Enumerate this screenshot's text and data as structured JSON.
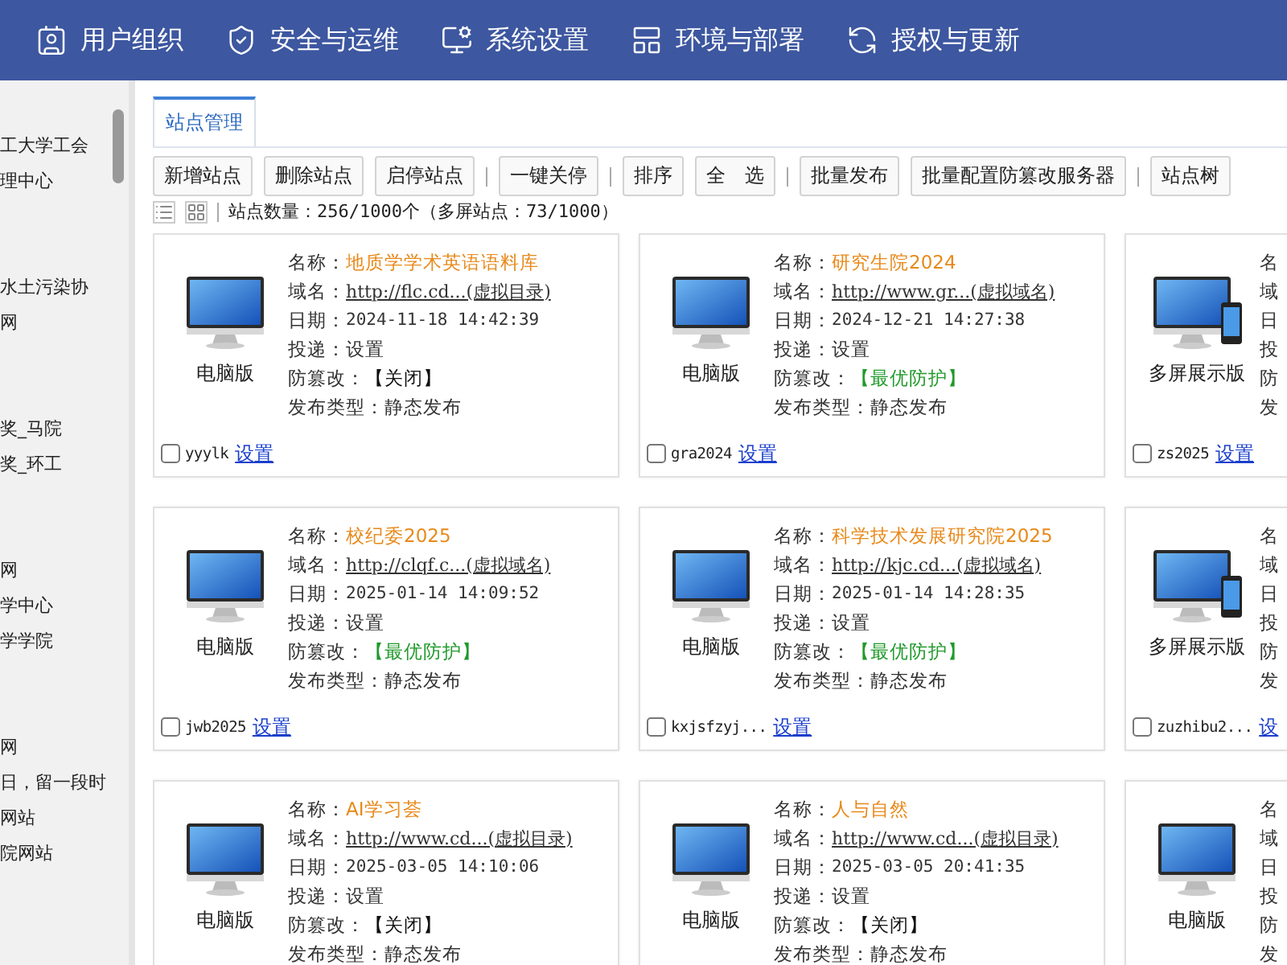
{
  "nav": {
    "items": [
      {
        "label": "用户组织"
      },
      {
        "label": "安全与运维"
      },
      {
        "label": "系统设置"
      },
      {
        "label": "环境与部署"
      },
      {
        "label": "授权与更新"
      }
    ]
  },
  "sidebar": {
    "groups": [
      {
        "lines": [
          "工大学工会",
          "理中心"
        ]
      },
      {
        "lines": [
          "水土污染协",
          "网"
        ]
      },
      {
        "lines": [
          "奖_马院",
          "奖_环工"
        ]
      },
      {
        "lines": [
          "网",
          "学中心",
          "学学院"
        ]
      },
      {
        "lines": [
          "网",
          "日，留一段时",
          "网站",
          "院网站"
        ]
      }
    ]
  },
  "tabs": [
    {
      "label": "站点管理",
      "selected": true
    }
  ],
  "toolbar": [
    {
      "kind": "button",
      "label": "新增站点"
    },
    {
      "kind": "button",
      "label": "删除站点"
    },
    {
      "kind": "button",
      "label": "启停站点"
    },
    {
      "kind": "separator"
    },
    {
      "kind": "button",
      "label": "一键关停"
    },
    {
      "kind": "separator"
    },
    {
      "kind": "button",
      "label": "排序"
    },
    {
      "kind": "button",
      "label": "全　选"
    },
    {
      "kind": "separator"
    },
    {
      "kind": "button",
      "label": "批量发布"
    },
    {
      "kind": "button",
      "label": "批量配置防篡改服务器"
    },
    {
      "kind": "separator"
    },
    {
      "kind": "button",
      "label": "站点树"
    }
  ],
  "status": {
    "text": "站点数量：256/1000个（多屏站点：73/1000）"
  },
  "cards": [
    {
      "kind": "pc",
      "device_label": "电脑版",
      "fields": [
        {
          "label": "名称：",
          "value": "地质学学术英语语料库",
          "kind": "title"
        },
        {
          "label": "域名：",
          "value": "http://flc.cd...(虚拟目录)",
          "kind": "url"
        },
        {
          "label": "日期：",
          "value": "2024-11-18 14:42:39",
          "kind": "plain"
        },
        {
          "label": "投递：",
          "value": "设置",
          "kind": "plain"
        },
        {
          "label": "防篡改：",
          "value": "【关闭】",
          "kind": "protection",
          "on": false
        },
        {
          "label": "发布类型：",
          "value": "静态发布",
          "kind": "plain"
        }
      ],
      "account": "yyylk",
      "link": "设置",
      "checked": false
    },
    {
      "kind": "pc",
      "device_label": "电脑版",
      "fields": [
        {
          "label": "名称：",
          "value": "研究生院2024",
          "kind": "title"
        },
        {
          "label": "域名：",
          "value": "http://www.gr...(虚拟域名)",
          "kind": "url"
        },
        {
          "label": "日期：",
          "value": "2024-12-21 14:27:38",
          "kind": "plain"
        },
        {
          "label": "投递：",
          "value": "设置",
          "kind": "plain"
        },
        {
          "label": "防篡改：",
          "value": "【最优防护】",
          "kind": "protection",
          "on": true
        },
        {
          "label": "发布类型：",
          "value": "静态发布",
          "kind": "plain"
        }
      ],
      "account": "gra2024",
      "link": "设置",
      "checked": false
    },
    {
      "kind": "multi",
      "device_label": "多屏展示版",
      "fields": [
        {
          "label": "名"
        },
        {
          "label": "域"
        },
        {
          "label": "日"
        },
        {
          "label": "投"
        },
        {
          "label": "防"
        },
        {
          "label": "发"
        }
      ],
      "account": "zs2025",
      "link": "设置",
      "checked": false
    },
    {
      "kind": "pc",
      "device_label": "电脑版",
      "fields": [
        {
          "label": "名称：",
          "value": "校纪委2025",
          "kind": "title"
        },
        {
          "label": "域名：",
          "value": "http://clqf.c...(虚拟域名)",
          "kind": "url"
        },
        {
          "label": "日期：",
          "value": "2025-01-14 14:09:52",
          "kind": "plain"
        },
        {
          "label": "投递：",
          "value": "设置",
          "kind": "plain"
        },
        {
          "label": "防篡改：",
          "value": "【最优防护】",
          "kind": "protection",
          "on": true
        },
        {
          "label": "发布类型：",
          "value": "静态发布",
          "kind": "plain"
        }
      ],
      "account": "jwb2025",
      "link": "设置",
      "checked": false
    },
    {
      "kind": "pc",
      "device_label": "电脑版",
      "fields": [
        {
          "label": "名称：",
          "value": "科学技术发展研究院2025",
          "kind": "title"
        },
        {
          "label": "域名：",
          "value": "http://kjc.cd...(虚拟域名)",
          "kind": "url"
        },
        {
          "label": "日期：",
          "value": "2025-01-14 14:28:35",
          "kind": "plain"
        },
        {
          "label": "投递：",
          "value": "设置",
          "kind": "plain"
        },
        {
          "label": "防篡改：",
          "value": "【最优防护】",
          "kind": "protection",
          "on": true
        },
        {
          "label": "发布类型：",
          "value": "静态发布",
          "kind": "plain"
        }
      ],
      "account": "kxjsfzyj...",
      "link": "设置",
      "checked": false
    },
    {
      "kind": "multi",
      "device_label": "多屏展示版",
      "fields": [
        {
          "label": "名"
        },
        {
          "label": "域"
        },
        {
          "label": "日"
        },
        {
          "label": "投"
        },
        {
          "label": "防"
        },
        {
          "label": "发"
        }
      ],
      "account": "zuzhibu2...",
      "link": "设",
      "checked": false
    },
    {
      "kind": "pc",
      "device_label": "电脑版",
      "fields": [
        {
          "label": "名称：",
          "value": "AI学习荟",
          "kind": "title"
        },
        {
          "label": "域名：",
          "value": "http://www.cd...(虚拟目录)",
          "kind": "url"
        },
        {
          "label": "日期：",
          "value": "2025-03-05 14:10:06",
          "kind": "plain"
        },
        {
          "label": "投递：",
          "value": "设置",
          "kind": "plain"
        },
        {
          "label": "防篡改：",
          "value": "【关闭】",
          "kind": "protection",
          "on": false
        },
        {
          "label": "发布类型：",
          "value": "静态发布",
          "kind": "plain"
        }
      ]
    },
    {
      "kind": "pc",
      "device_label": "电脑版",
      "fields": [
        {
          "label": "名称：",
          "value": "人与自然",
          "kind": "title"
        },
        {
          "label": "域名：",
          "value": "http://www.cd...(虚拟目录)",
          "kind": "url"
        },
        {
          "label": "日期：",
          "value": "2025-03-05 20:41:35",
          "kind": "plain"
        },
        {
          "label": "投递：",
          "value": "设置",
          "kind": "plain"
        },
        {
          "label": "防篡改：",
          "value": "【关闭】",
          "kind": "protection",
          "on": false
        },
        {
          "label": "发布类型：",
          "value": "静态发布",
          "kind": "plain"
        }
      ]
    },
    {
      "kind": "pc",
      "device_label": "电脑版",
      "fields": [
        {
          "label": "名"
        },
        {
          "label": "域"
        },
        {
          "label": "日"
        },
        {
          "label": "投"
        },
        {
          "label": "防"
        },
        {
          "label": "发"
        }
      ]
    }
  ]
}
